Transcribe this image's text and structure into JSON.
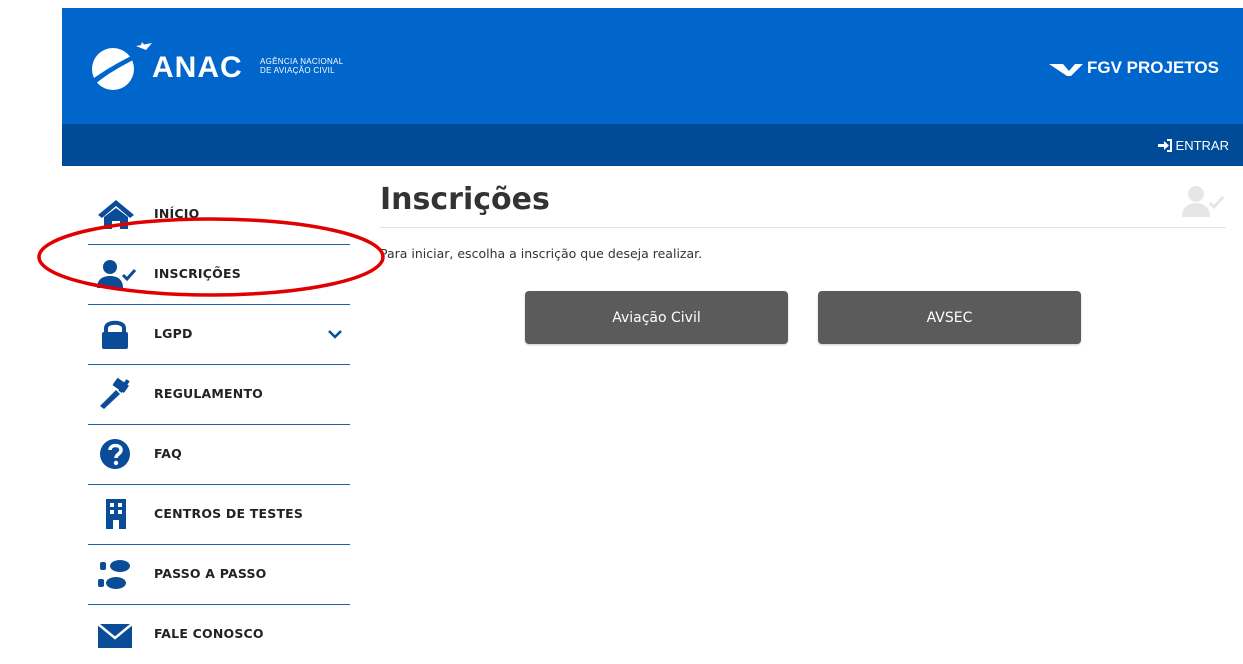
{
  "header": {
    "brand": "ANAC",
    "brand_subtitle_line1": "AGÊNCIA NACIONAL",
    "brand_subtitle_line2": "DE AVIAÇÃO CIVIL",
    "partner": "FGV PROJETOS",
    "login_label": "ENTRAR",
    "background_color": "#0066cc",
    "subbar_color": "#004b97"
  },
  "sidebar": {
    "icon_color": "#0b4c98",
    "items": [
      {
        "label": "INÍCIO",
        "icon": "home-icon"
      },
      {
        "label": "INSCRIÇÕES",
        "icon": "user-check-icon"
      },
      {
        "label": "LGPD",
        "icon": "lock-icon",
        "expandable": true
      },
      {
        "label": "REGULAMENTO",
        "icon": "gavel-icon"
      },
      {
        "label": "FAQ",
        "icon": "question-circle-icon"
      },
      {
        "label": "CENTROS DE TESTES",
        "icon": "building-icon"
      },
      {
        "label": "PASSO A PASSO",
        "icon": "footsteps-icon"
      },
      {
        "label": "FALE CONOSCO",
        "icon": "envelope-icon"
      }
    ]
  },
  "main": {
    "title": "Inscrições",
    "instruction": "Para iniciar, escolha a inscrição que deseja realizar.",
    "buttons": [
      {
        "label": "Aviação Civil"
      },
      {
        "label": "AVSEC"
      }
    ],
    "button_color": "#5b5b5b"
  },
  "annotation": {
    "shape": "ellipse",
    "color": "#e00000"
  }
}
